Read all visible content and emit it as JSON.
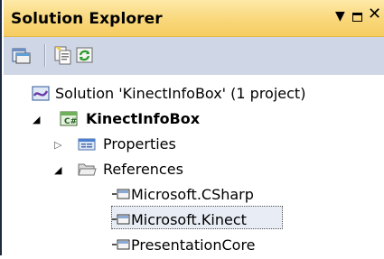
{
  "panel": {
    "title": "Solution Explorer",
    "dropdown_glyph": "▼",
    "close_glyph": "✕"
  },
  "toolbar": {
    "buttons": [
      {
        "icon": "show-all-files-icon"
      },
      {
        "icon": "properties-icon"
      },
      {
        "icon": "refresh-icon"
      }
    ]
  },
  "tree": {
    "solution": {
      "label": "Solution 'KinectInfoBox' (1 project)",
      "icon": "solution-icon"
    },
    "project": {
      "label": "KinectInfoBox",
      "icon": "csharp-project-icon",
      "expanded": true
    },
    "properties": {
      "label": "Properties",
      "icon": "properties-folder-icon",
      "expanded": false
    },
    "references": {
      "label": "References",
      "icon": "references-folder-icon",
      "expanded": true,
      "items": [
        {
          "label": "Microsoft.CSharp",
          "icon": "reference-icon"
        },
        {
          "label": "Microsoft.Kinect",
          "icon": "reference-icon",
          "selected": true
        },
        {
          "label": "PresentationCore",
          "icon": "reference-icon"
        }
      ]
    }
  },
  "colors": {
    "title_gradient_top": "#fde9a8",
    "title_gradient_bottom": "#f6cd62",
    "toolbar_bg": "#cfd6e5",
    "tree_bg": "#ffffff",
    "frame_border": "#1e2a40"
  }
}
